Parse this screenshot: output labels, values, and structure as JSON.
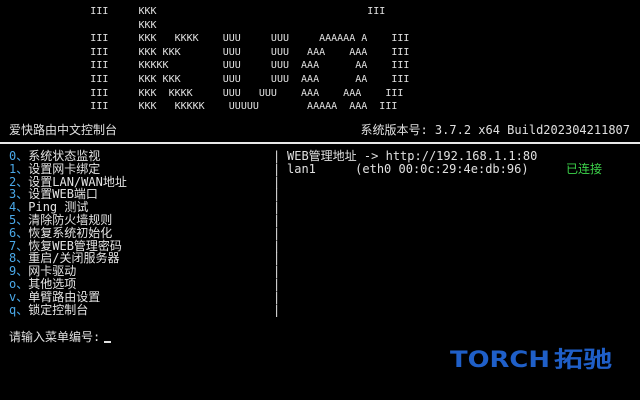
{
  "banner": {
    "lines": [
      "               III     KKK                                   III",
      "                       KKK",
      "               III     KKK   KKKK    UUU     UUU     AAAAAA A    III",
      "               III     KKK KKK       UUU     UUU   AAA    AAA    III",
      "               III     KKKKK         UUU     UUU  AAA      AA    III",
      "               III     KKK KKK       UUU     UUU  AAA      AA    III",
      "               III     KKK  KKKK     UUU   UUU    AAA    AAA    III",
      "               III     KKK   KKKKK    UUUUU        AAAAA  AAA  III"
    ]
  },
  "header": {
    "title": "爱快路由中文控制台",
    "version": "系统版本号: 3.7.2 x64 Build202304211807"
  },
  "menu": {
    "separator": "、",
    "items": [
      {
        "key": "0",
        "label": "系统状态监视"
      },
      {
        "key": "1",
        "label": "设置网卡绑定"
      },
      {
        "key": "2",
        "label": "设置LAN/WAN地址"
      },
      {
        "key": "3",
        "label": "设置WEB端口"
      },
      {
        "key": "4",
        "label": "Ping 测试"
      },
      {
        "key": "5",
        "label": "清除防火墙规则"
      },
      {
        "key": "6",
        "label": "恢复系统初始化"
      },
      {
        "key": "7",
        "label": "恢复WEB管理密码"
      },
      {
        "key": "8",
        "label": "重启/关闭服务器"
      },
      {
        "key": "9",
        "label": "网卡驱动"
      },
      {
        "key": "o",
        "label": "其他选项"
      },
      {
        "key": "v",
        "label": "单臂路由设置"
      },
      {
        "key": "q",
        "label": "锁定控制台"
      }
    ]
  },
  "separator_glyph": "|",
  "info": {
    "web_label": "WEB管理地址",
    "web_arrow": "->",
    "web_url": "http://192.168.1.1:80",
    "lan_name": "lan1",
    "lan_iface": "(eth0",
    "lan_mac": "00:0c:29:4e:db:96)",
    "lan_status": "已连接",
    "lan_status_color": "#3cd34a"
  },
  "prompt": {
    "text": "请输入菜单编号:"
  },
  "brand": {
    "latin": "TORCH",
    "chinese": "拓驰",
    "color": "#1f5fc8"
  },
  "colors": {
    "background": "#000000",
    "text": "#e0e0e0",
    "menu_key": "#4aa8e8"
  }
}
